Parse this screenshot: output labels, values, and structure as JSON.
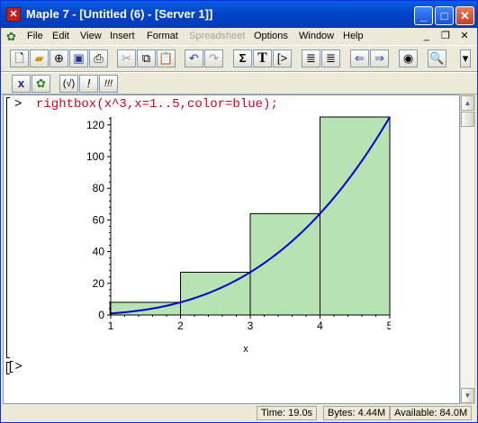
{
  "window": {
    "title": "Maple 7  - [Untitled (6) - [Server 1]]",
    "app_icon": "maple-leaf-icon",
    "controls": [
      "minimize",
      "maximize",
      "close"
    ]
  },
  "menu": {
    "items": [
      {
        "label": "File",
        "enabled": true
      },
      {
        "label": "Edit",
        "enabled": true
      },
      {
        "label": "View",
        "enabled": true
      },
      {
        "label": "Insert",
        "enabled": true
      },
      {
        "label": "Format",
        "enabled": true
      },
      {
        "label": "Spreadsheet",
        "enabled": false
      },
      {
        "label": "Options",
        "enabled": true
      },
      {
        "label": "Window",
        "enabled": true
      },
      {
        "label": "Help",
        "enabled": true
      }
    ],
    "doc_controls": [
      "minimize",
      "restore",
      "close"
    ]
  },
  "toolbar_main": {
    "buttons": [
      {
        "icon": "new-document-icon"
      },
      {
        "icon": "open-folder-icon"
      },
      {
        "icon": "open-url-icon"
      },
      {
        "icon": "save-icon"
      },
      {
        "icon": "print-icon"
      },
      {
        "icon": "cut-icon",
        "enabled": false
      },
      {
        "icon": "copy-icon"
      },
      {
        "icon": "paste-icon"
      },
      {
        "icon": "undo-icon"
      },
      {
        "icon": "redo-icon",
        "enabled": false
      },
      {
        "icon": "sigma-icon",
        "glyph": "Σ"
      },
      {
        "icon": "text-T-icon",
        "glyph": "T"
      },
      {
        "icon": "execution-group-icon",
        "glyph": "[>"
      },
      {
        "icon": "outdent-icon"
      },
      {
        "icon": "indent-icon"
      },
      {
        "icon": "back-arrow-icon"
      },
      {
        "icon": "forward-arrow-icon"
      },
      {
        "icon": "stop-icon"
      },
      {
        "icon": "zoom-icon"
      }
    ]
  },
  "toolbar_context": {
    "buttons": [
      {
        "icon": "maple-input-icon",
        "glyph": "x"
      },
      {
        "icon": "maple-leaf-icon"
      },
      {
        "icon": "evaluate-icon",
        "glyph": "(√)"
      },
      {
        "icon": "execute-icon",
        "glyph": "!"
      },
      {
        "icon": "execute-all-icon",
        "glyph": "!!!"
      }
    ]
  },
  "worksheet": {
    "prompt_symbol": ">",
    "command": "rightbox(x^3,x=1..5,color=blue);",
    "next_prompt": "[>"
  },
  "status": {
    "time": "Time:  19.0s",
    "bytes": "Bytes: 4.44M",
    "available": "Available: 84.0M"
  },
  "chart_data": {
    "type": "bar",
    "subtype": "rightbox Riemann sum with curve",
    "title": "",
    "xlabel": "x",
    "ylabel": "",
    "xlim": [
      1,
      5
    ],
    "ylim": [
      0,
      125
    ],
    "xticks": [
      1,
      2,
      3,
      4,
      5
    ],
    "yticks": [
      0,
      20,
      40,
      60,
      80,
      100,
      120
    ],
    "boxes": [
      {
        "x0": 0.99,
        "x1": 2,
        "height": 8
      },
      {
        "x0": 2,
        "x1": 3,
        "height": 27
      },
      {
        "x0": 3,
        "x1": 4,
        "height": 64
      },
      {
        "x0": 4,
        "x1": 5,
        "height": 125
      }
    ],
    "curve": {
      "expression": "x^3",
      "color": "#0000cc"
    },
    "box_fill": "#b7e3b4",
    "box_stroke": "#000000"
  }
}
